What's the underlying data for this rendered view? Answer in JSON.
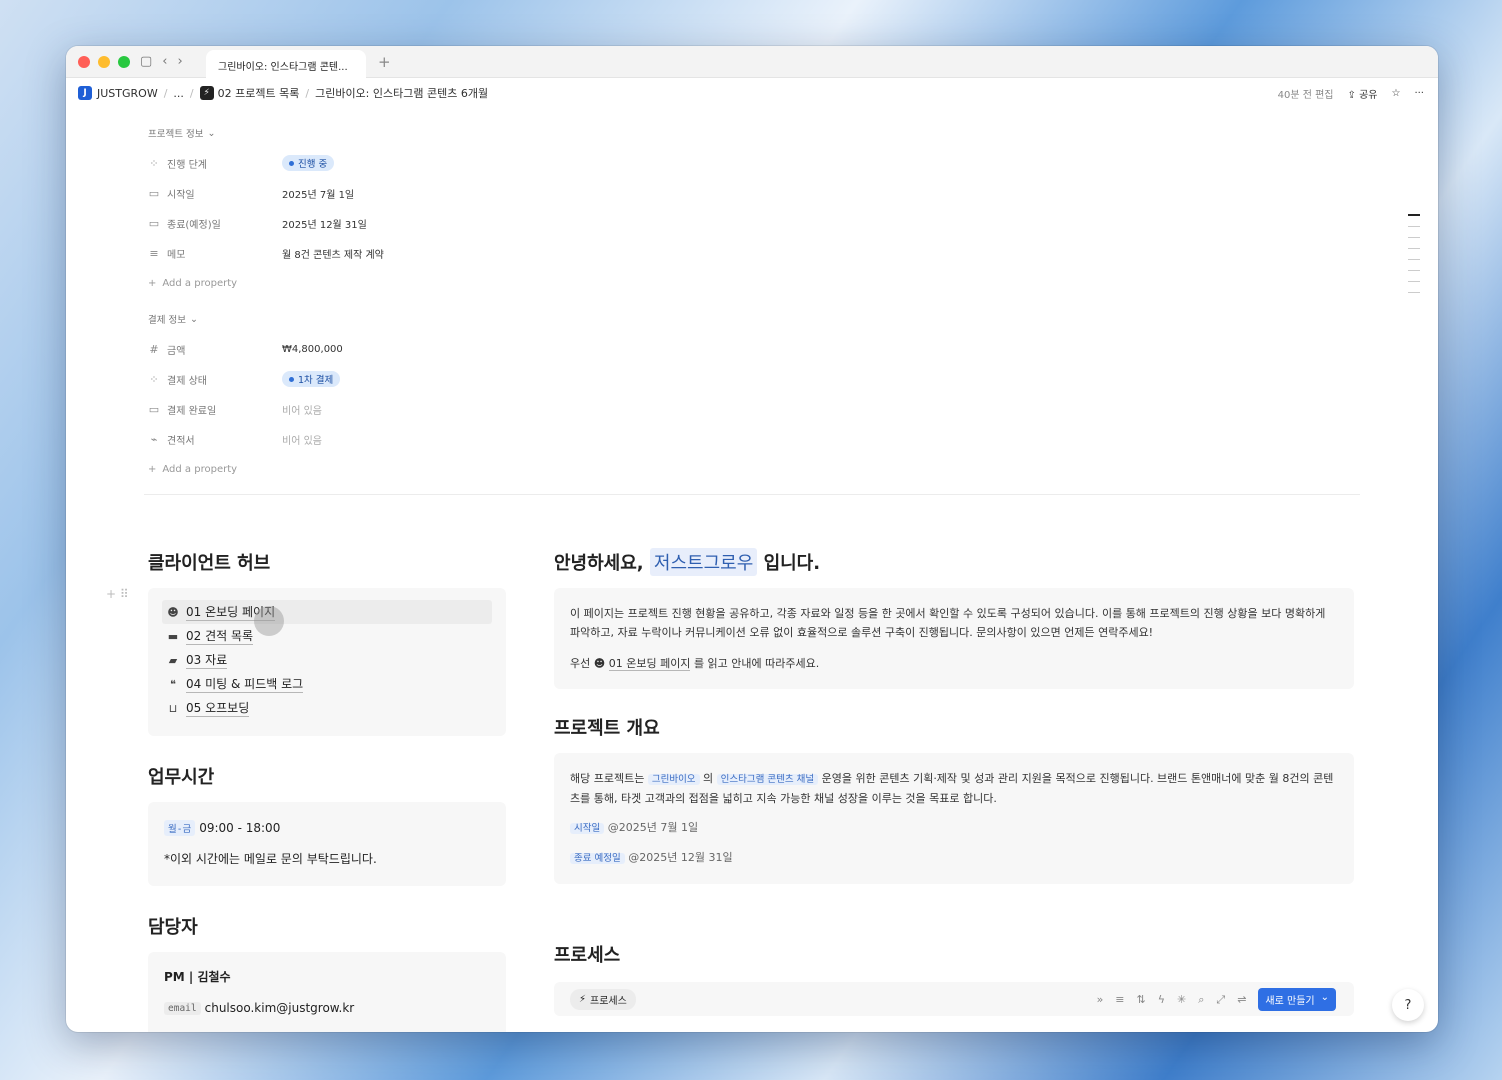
{
  "tab": {
    "title": "그린바이오: 인스타그램 콘텐..."
  },
  "breadcrumb": {
    "workspace": "JUSTGROW",
    "ellipsis": "...",
    "project_list": "02 프로젝트 목록",
    "page": "그린바이오: 인스타그램 콘텐츠 6개월",
    "edited": "40분 전 편집",
    "share": "공유"
  },
  "project_info": {
    "header": "프로젝트 정보",
    "rows": [
      {
        "label": "진행 단계",
        "value": "진행 중",
        "kind": "pill"
      },
      {
        "label": "시작일",
        "value": "2025년 7월 1일"
      },
      {
        "label": "종료(예정)일",
        "value": "2025년 12월 31일"
      },
      {
        "label": "메모",
        "value": "월 8건 콘텐츠 제작 계약"
      }
    ],
    "add_property": "Add a property"
  },
  "payment_info": {
    "header": "결제 정보",
    "rows": [
      {
        "label": "금액",
        "value": "₩4,800,000"
      },
      {
        "label": "결제 상태",
        "value": "1차 결제",
        "kind": "pill"
      },
      {
        "label": "결제 완료일",
        "value": "비어 있음",
        "kind": "empty"
      },
      {
        "label": "견적서",
        "value": "비어 있음",
        "kind": "empty"
      }
    ],
    "add_property": "Add a property"
  },
  "client_hub": {
    "title": "클라이언트 허브",
    "items": [
      "01 온보딩 페이지",
      "02 견적 목록",
      "03 자료",
      "04 미팅 & 피드백 로그",
      "05 오프보딩"
    ]
  },
  "hours": {
    "title": "업무시간",
    "days_tag": "월-금",
    "time": "09:00 - 18:00",
    "note": "*이외 시간에는 메일로 문의 부탁드립니다."
  },
  "manager": {
    "title": "담당자",
    "role_name": "PM | 김철수",
    "email_tag": "email",
    "email": "chulsoo.kim@justgrow.kr"
  },
  "greeting": {
    "prefix": "안녕하세요,",
    "name": "저스트그로우",
    "suffix": "입니다.",
    "body": "이 페이지는 프로젝트 진행 현황을 공유하고, 각종 자료와 일정 등을 한 곳에서 확인할 수 있도록 구성되어 있습니다. 이를 통해 프로젝트의 진행 상황을 보다 명확하게 파악하고, 자료 누락이나 커뮤니케이션 오류 없이 효율적으로 솔루션 구축이 진행됩니다. 문의사항이 있으면 언제든 연락주세요!",
    "first_prefix": "우선",
    "first_link": "01 온보딩 페이지",
    "first_suffix": "를 읽고 안내에 따라주세요."
  },
  "overview": {
    "title": "프로젝트 개요",
    "lead": "해당 프로젝트는",
    "client_tag": "그린바이오",
    "mid": "의",
    "channel_tag": "인스타그램 콘텐츠 채널",
    "body": "운영을 위한 콘텐츠 기획·제작 및 성과 관리 지원을 목적으로 진행됩니다. 브랜드 톤앤매너에 맞춘 월 8건의 콘텐츠를 통해, 타겟 고객과의 접점을 넓히고 지속 가능한 채널 성장을 이루는 것을 목표로 합니다.",
    "start_tag": "시작일",
    "start_date": "@2025년 7월 1일",
    "end_tag": "종료 예정일",
    "end_date": "@2025년 12월 31일"
  },
  "process": {
    "title": "프로세스",
    "view_chip": "프로세스",
    "new_button": "새로 만들기"
  }
}
